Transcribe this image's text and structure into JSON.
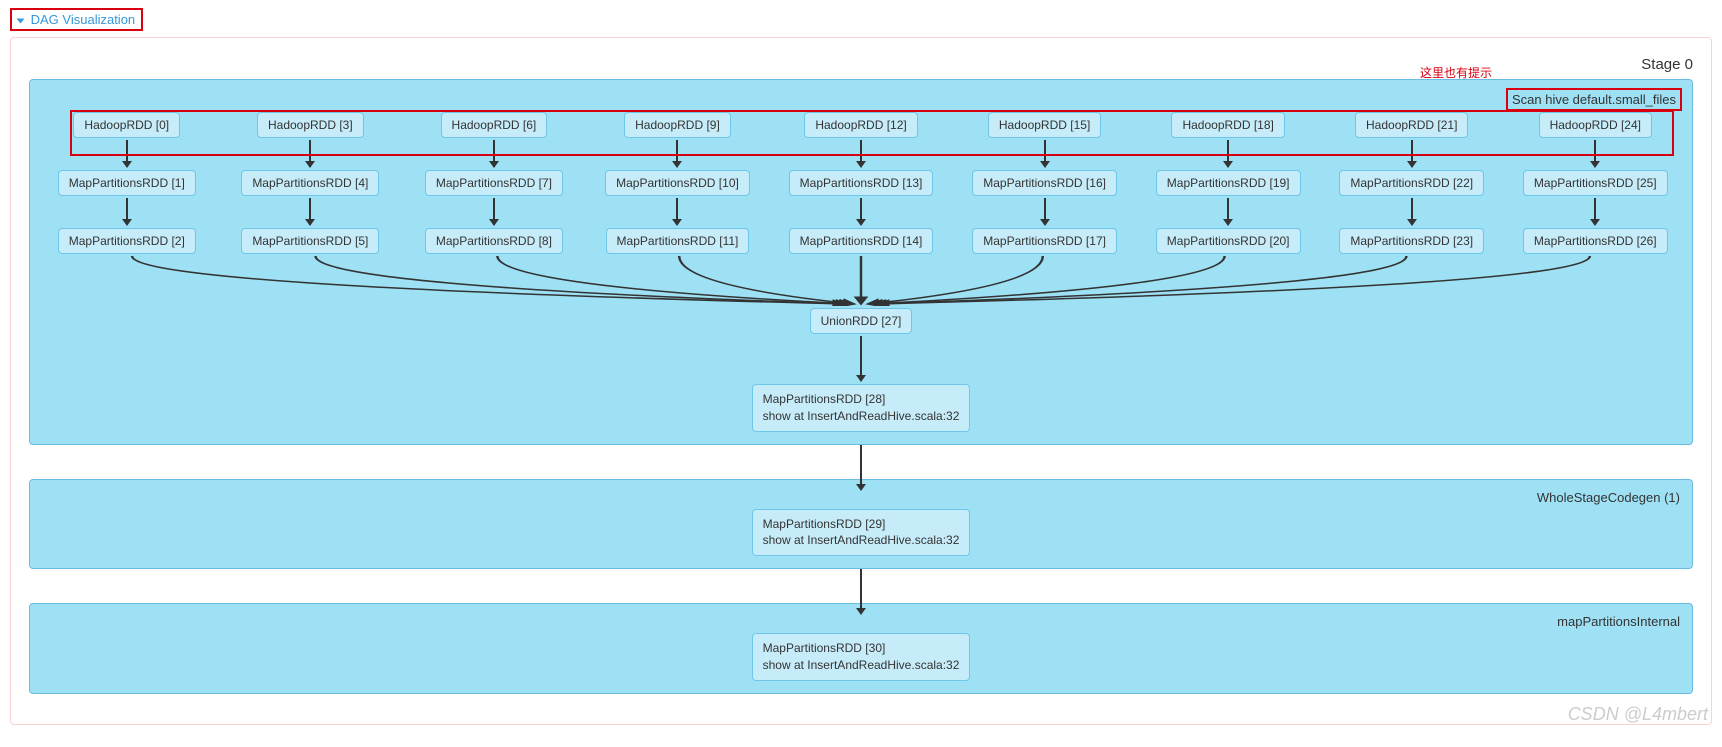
{
  "header": {
    "link_label": "DAG Visualization"
  },
  "annotations": {
    "hint_text": "这里也有提示"
  },
  "stage": {
    "title": "Stage 0",
    "scan_cluster": {
      "label": "Scan hive default.small_files",
      "columns": [
        {
          "hadoop": "HadoopRDD [0]",
          "mp1": "MapPartitionsRDD [1]",
          "mp2": "MapPartitionsRDD [2]"
        },
        {
          "hadoop": "HadoopRDD [3]",
          "mp1": "MapPartitionsRDD [4]",
          "mp2": "MapPartitionsRDD [5]"
        },
        {
          "hadoop": "HadoopRDD [6]",
          "mp1": "MapPartitionsRDD [7]",
          "mp2": "MapPartitionsRDD [8]"
        },
        {
          "hadoop": "HadoopRDD [9]",
          "mp1": "MapPartitionsRDD [10]",
          "mp2": "MapPartitionsRDD [11]"
        },
        {
          "hadoop": "HadoopRDD [12]",
          "mp1": "MapPartitionsRDD [13]",
          "mp2": "MapPartitionsRDD [14]"
        },
        {
          "hadoop": "HadoopRDD [15]",
          "mp1": "MapPartitionsRDD [16]",
          "mp2": "MapPartitionsRDD [17]"
        },
        {
          "hadoop": "HadoopRDD [18]",
          "mp1": "MapPartitionsRDD [19]",
          "mp2": "MapPartitionsRDD [20]"
        },
        {
          "hadoop": "HadoopRDD [21]",
          "mp1": "MapPartitionsRDD [22]",
          "mp2": "MapPartitionsRDD [23]"
        },
        {
          "hadoop": "HadoopRDD [24]",
          "mp1": "MapPartitionsRDD [25]",
          "mp2": "MapPartitionsRDD [26]"
        }
      ],
      "union": "UnionRDD [27]",
      "mp28_line1": "MapPartitionsRDD [28]",
      "mp28_line2": "show at InsertAndReadHive.scala:32"
    },
    "codegen_cluster": {
      "label": "WholeStageCodegen (1)",
      "mp29_line1": "MapPartitionsRDD [29]",
      "mp29_line2": "show at InsertAndReadHive.scala:32"
    },
    "internal_cluster": {
      "label": "mapPartitionsInternal",
      "mp30_line1": "MapPartitionsRDD [30]",
      "mp30_line2": "show at InsertAndReadHive.scala:32"
    }
  },
  "watermark": "CSDN @L4mbert"
}
